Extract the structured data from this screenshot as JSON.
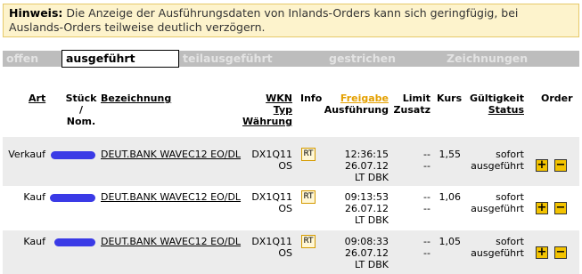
{
  "notice": {
    "label": "Hinweis:",
    "text": "Die Anzeige der Ausführungsdaten von Inlands-Orders kann sich geringfügig, bei Auslands-Orders teilweise deutlich verzögern."
  },
  "tabs": [
    "offen",
    "ausgeführt",
    "teilausgeführt",
    "gestrichen",
    "Zeichnungen"
  ],
  "active_tab": "ausgeführt",
  "headers": {
    "art": "Art",
    "stueck": "Stück /",
    "nom": "Nom.",
    "bezeichnung": "Bezeichnung",
    "wkn": "WKN",
    "typ": "Typ",
    "waehrung": "Währung",
    "info": "Info",
    "freigabe": "Freigabe",
    "ausfuehrung": "Ausführung",
    "limit": "Limit",
    "zusatz": "Zusatz",
    "kurs": "Kurs",
    "gueltigkeit": "Gültigkeit",
    "status": "Status",
    "order": "Order"
  },
  "rows": [
    {
      "art": "Verkauf",
      "bezeichnung": "DEUT.BANK WAVEC12 EO/DL",
      "wkn": "DX1Q11",
      "typ": "OS",
      "info": "RT",
      "time": "12:36:15",
      "date": "26.07.12",
      "venue": "LT DBK",
      "limit": "--",
      "zusatz": "--",
      "kurs": "1,55",
      "gueltigkeit": "sofort",
      "status": "ausgeführt",
      "plus": "+",
      "minus": "−"
    },
    {
      "art": "Kauf",
      "bezeichnung": "DEUT.BANK WAVEC12 EO/DL",
      "wkn": "DX1Q11",
      "typ": "OS",
      "info": "RT",
      "time": "09:13:53",
      "date": "26.07.12",
      "venue": "LT DBK",
      "limit": "--",
      "zusatz": "--",
      "kurs": "1,06",
      "gueltigkeit": "sofort",
      "status": "ausgeführt",
      "plus": "+",
      "minus": "−"
    },
    {
      "art": "Kauf",
      "bezeichnung": "DEUT.BANK WAVEC12 EO/DL",
      "wkn": "DX1Q11",
      "typ": "OS",
      "info": "RT",
      "time": "09:08:33",
      "date": "26.07.12",
      "venue": "LT DBK",
      "limit": "--",
      "zusatz": "--",
      "kurs": "1,05",
      "gueltigkeit": "sofort",
      "status": "ausgeführt",
      "plus": "+",
      "minus": "−"
    }
  ],
  "colors": {
    "notice_bg": "#fdf3cc",
    "tab_bar": "#bdbdbd",
    "row_shade": "#ececec",
    "redaction": "#3a3ae6",
    "accent": "#e4a000"
  }
}
